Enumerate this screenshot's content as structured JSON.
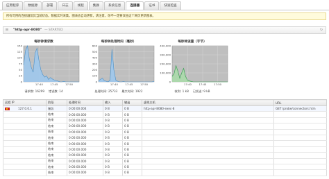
{
  "tabs": [
    "应用程序",
    "数据源",
    "部署",
    "日志",
    "线程",
    "集群",
    "系统信息",
    "连接器",
    "证书",
    "快速检查"
  ],
  "active_tab_index": 7,
  "notice": "所有可用的连接器及其当前状态。数据实时采集，图表会自动更新。请注意，你不一定要双击这个网页更新图表。",
  "connector": {
    "expand_icon": "minus-box-icon",
    "name": "\"http-apr-8080\"",
    "state": "— STARTED",
    "refresh_icon": "refresh-icon"
  },
  "charts": [
    {
      "title": "每秒钟请求数",
      "stats": [
        "请求数: 16299",
        "错误数: 14"
      ],
      "color": "#9cc8ee",
      "line": "#4a90c8",
      "chart_data": {
        "type": "area",
        "title": "每秒钟请求数",
        "x": [
          "17:40",
          "17:45",
          "17:50"
        ],
        "yticks": [
          "0",
          "25",
          "50",
          "75",
          "100",
          "125",
          "150"
        ],
        "ylim": [
          0,
          150
        ],
        "values": [
          70,
          130,
          150,
          95,
          60,
          40,
          120,
          140,
          90,
          50,
          30,
          20,
          25,
          10,
          18,
          12,
          8,
          5,
          3,
          0,
          0,
          2,
          0,
          0,
          0,
          0,
          0,
          0,
          0,
          0
        ]
      }
    },
    {
      "title": "每秒钟处理时间（毫秒）",
      "stats": [
        "处理时间: 25733",
        "最大时间: 1922"
      ],
      "color": "#9cc8ee",
      "line": "#4a90c8",
      "chart_data": {
        "type": "area",
        "title": "每秒钟处理时间（毫秒）",
        "x": [
          "17:40",
          "17:45",
          "17:50"
        ],
        "yticks": [
          "0",
          "100",
          "200",
          "300",
          "400",
          "500",
          "600"
        ],
        "ylim": [
          0,
          600
        ],
        "values": [
          20,
          40,
          60,
          20,
          10,
          0,
          30,
          540,
          200,
          30,
          10,
          0,
          0,
          5,
          0,
          0,
          0,
          0,
          0,
          0,
          0,
          0,
          0,
          0,
          0,
          0,
          0,
          0,
          0,
          10
        ]
      }
    },
    {
      "title": "每秒钟流量（字节）",
      "stats": [
        "收到: 1 kB",
        "已发送: 9 kB"
      ],
      "color": "#a9dca9",
      "line": "#2e9a4a",
      "chart_data": {
        "type": "area",
        "title": "每秒钟流量（字节）",
        "x": [
          "17:40",
          "17:45",
          "17:50"
        ],
        "yticks": [
          "0",
          "100,000",
          "200,000",
          "300,000",
          "400,000"
        ],
        "ylim": [
          0,
          400000
        ],
        "values": [
          60000,
          90000,
          180000,
          120000,
          40000,
          100000,
          150000,
          60000,
          20000,
          10000,
          5000,
          0,
          0,
          0,
          0,
          0,
          0,
          0,
          0,
          0,
          0,
          0,
          0,
          0,
          0,
          0,
          0,
          0,
          0,
          0
        ]
      }
    }
  ],
  "table": {
    "headers": [
      "远程 IP",
      "阶段",
      "处理时间",
      "输入",
      "输出",
      "虚拟主机",
      "URL"
    ],
    "rows": [
      {
        "ip": "127.0.0.1",
        "flag": true,
        "stage": "服务",
        "time": "0:00:00.004",
        "in": "0 B",
        "out": "0 B",
        "vhost": "http-apr-8080-exec-8",
        "url": "GET /probe/connectors.htm"
      },
      {
        "ip": "",
        "flag": false,
        "stage": "结束",
        "time": "0:00:00.000",
        "in": "0 B",
        "out": "0 B",
        "vhost": "",
        "url": ""
      },
      {
        "ip": "",
        "flag": false,
        "stage": "结束",
        "time": "0:00:00.000",
        "in": "0 B",
        "out": "0 B",
        "vhost": "",
        "url": ""
      },
      {
        "ip": "",
        "flag": false,
        "stage": "结束",
        "time": "0:00:00.000",
        "in": "0 B",
        "out": "0 B",
        "vhost": "",
        "url": ""
      },
      {
        "ip": "",
        "flag": false,
        "stage": "结束",
        "time": "0:00:00.000",
        "in": "0 B",
        "out": "0 B",
        "vhost": "",
        "url": ""
      },
      {
        "ip": "",
        "flag": false,
        "stage": "结束",
        "time": "0:00:00.000",
        "in": "0 B",
        "out": "0 B",
        "vhost": "",
        "url": ""
      },
      {
        "ip": "",
        "flag": false,
        "stage": "结束",
        "time": "0:00:00.000",
        "in": "0 B",
        "out": "0 B",
        "vhost": "",
        "url": ""
      },
      {
        "ip": "",
        "flag": false,
        "stage": "结束",
        "time": "0:00:00.000",
        "in": "0 B",
        "out": "0 B",
        "vhost": "",
        "url": ""
      },
      {
        "ip": "",
        "flag": false,
        "stage": "结束",
        "time": "0:00:00.000",
        "in": "0 B",
        "out": "0 B",
        "vhost": "",
        "url": ""
      },
      {
        "ip": "",
        "flag": false,
        "stage": "结束",
        "time": "0:00:00.000",
        "in": "0 B",
        "out": "0 B",
        "vhost": "",
        "url": ""
      },
      {
        "ip": "",
        "flag": false,
        "stage": "结束",
        "time": "0:00:00.000",
        "in": "0 B",
        "out": "0 B",
        "vhost": "",
        "url": ""
      },
      {
        "ip": "",
        "flag": false,
        "stage": "结束",
        "time": "0:00:00.000",
        "in": "0 B",
        "out": "0 B",
        "vhost": "",
        "url": ""
      }
    ]
  }
}
